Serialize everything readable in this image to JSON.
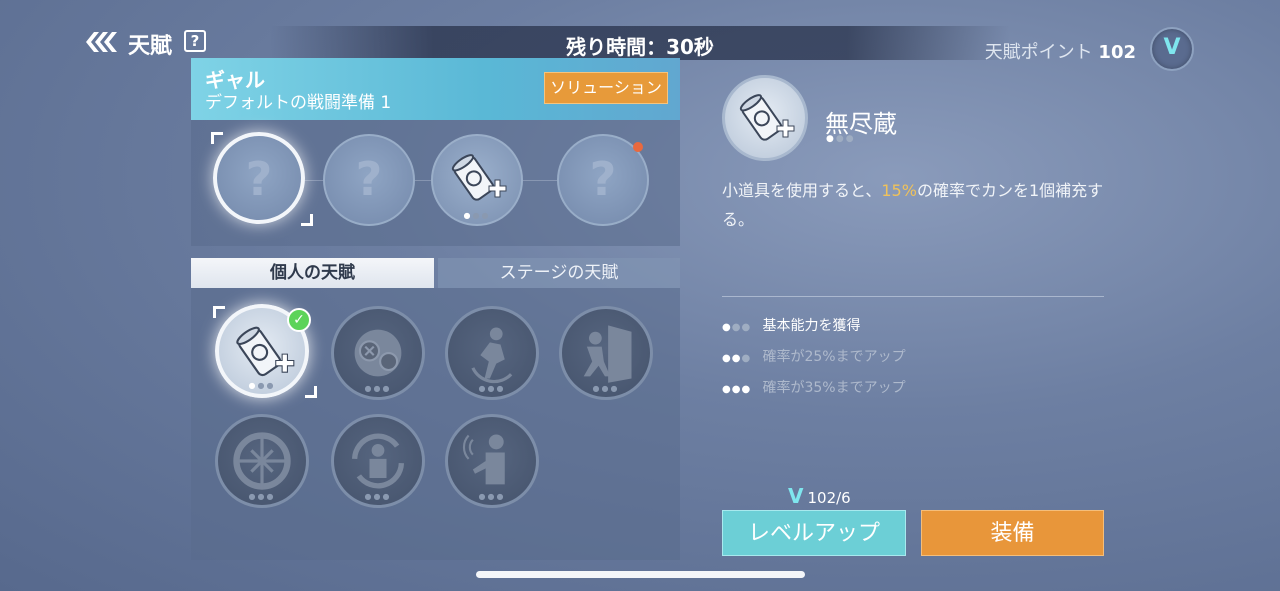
{
  "header": {
    "title": "天賦",
    "help": "?",
    "timer": "残り時間：30秒",
    "points_label": "天賦ポイント",
    "points_value": "102",
    "badge": "V"
  },
  "character": {
    "name": "ギャル",
    "subtitle": "デフォルトの戦闘準備 1",
    "solution_button": "ソリューション"
  },
  "slots": [
    {
      "type": "unknown",
      "label": "?",
      "selected": true
    },
    {
      "type": "unknown",
      "label": "?"
    },
    {
      "type": "can-plus-icon"
    },
    {
      "type": "unknown",
      "label": "?",
      "notification": true
    }
  ],
  "tabs": {
    "personal": "個人の天賦",
    "stage": "ステージの天賦"
  },
  "talents": [
    {
      "icon": "can-plus-icon",
      "selected": true,
      "equipped": true
    },
    {
      "icon": "diving-helmet-icon"
    },
    {
      "icon": "crouching-runner-icon"
    },
    {
      "icon": "escaping-door-icon"
    },
    {
      "icon": "crosshair-target-icon"
    },
    {
      "icon": "rotation-person-icon"
    },
    {
      "icon": "waving-person-icon"
    }
  ],
  "detail": {
    "name": "無尽蔵",
    "desc_pre": "小道具を使用すると、",
    "desc_highlight": "15%",
    "desc_post": "の確率でカンを1個補充する。",
    "levels": [
      {
        "text": "基本能力を獲得",
        "active": true
      },
      {
        "text": "確率が25%までアップ",
        "active": false
      },
      {
        "text": "確率が35%までアップ",
        "active": false
      }
    ]
  },
  "actions": {
    "cost_icon": "V",
    "cost": "102/6",
    "level_up": "レベルアップ",
    "equip": "装備"
  },
  "colors": {
    "accent_cyan": "#6ccfd6",
    "accent_orange": "#e8963a",
    "highlight": "#f0c25a",
    "notification": "#e9693e",
    "check": "#5dd35a"
  }
}
